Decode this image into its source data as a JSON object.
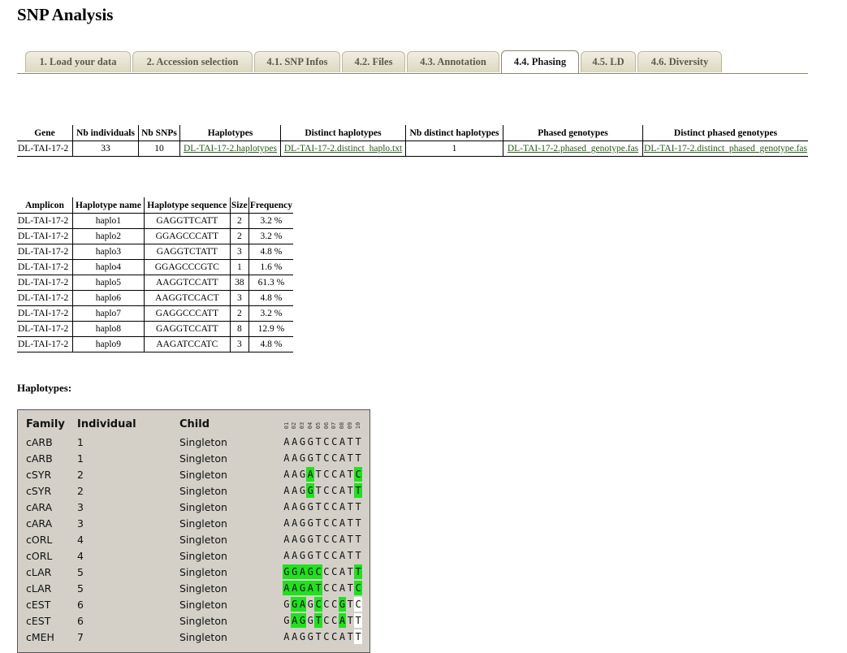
{
  "page": {
    "title": "SNP Analysis"
  },
  "tabs": [
    {
      "label": "1. Load your data",
      "active": false
    },
    {
      "label": "2. Accession selection",
      "active": false
    },
    {
      "label": "4.1. SNP Infos",
      "active": false
    },
    {
      "label": "4.2. Files",
      "active": false
    },
    {
      "label": "4.3. Annotation",
      "active": false
    },
    {
      "label": "4.4. Phasing",
      "active": true
    },
    {
      "label": "4.5. LD",
      "active": false
    },
    {
      "label": "4.6. Diversity",
      "active": false
    }
  ],
  "summary": {
    "headers": [
      "Gene",
      "Nb individuals",
      "Nb SNPs",
      "Haplotypes",
      "Distinct haplotypes",
      "Nb distinct haplotypes",
      "Phased genotypes",
      "Distinct phased genotypes"
    ],
    "row": {
      "gene": "DL-TAI-17-2",
      "nb_individuals": "33",
      "nb_snps": "10",
      "haplotypes_link": "DL-TAI-17-2.haplotypes",
      "distinct_haplotypes_link": "DL-TAI-17-2.distinct_haplo.txt",
      "nb_distinct_haplotypes": "1",
      "phased_genotypes_link": "DL-TAI-17-2.phased_genotype.fas",
      "distinct_phased_genotypes_link": "DL-TAI-17-2.distinct_phased_genotype.fas"
    }
  },
  "haplo_table": {
    "headers": [
      "Amplicon",
      "Haplotype name",
      "Haplotype sequence",
      "Size",
      "Frequency"
    ],
    "rows": [
      [
        "DL-TAI-17-2",
        "haplo1",
        "GAGGTTCATT",
        "2",
        "3.2 %"
      ],
      [
        "DL-TAI-17-2",
        "haplo2",
        "GGAGCCCATT",
        "2",
        "3.2 %"
      ],
      [
        "DL-TAI-17-2",
        "haplo3",
        "GAGGTCTATT",
        "3",
        "4.8 %"
      ],
      [
        "DL-TAI-17-2",
        "haplo4",
        "GGAGCCCGTC",
        "1",
        "1.6 %"
      ],
      [
        "DL-TAI-17-2",
        "haplo5",
        "AAGGTCCATT",
        "38",
        "61.3 %"
      ],
      [
        "DL-TAI-17-2",
        "haplo6",
        "AAGGTCCACT",
        "3",
        "4.8 %"
      ],
      [
        "DL-TAI-17-2",
        "haplo7",
        "GAGGCCCATT",
        "2",
        "3.2 %"
      ],
      [
        "DL-TAI-17-2",
        "haplo8",
        "GAGGTCCATT",
        "8",
        "12.9 %"
      ],
      [
        "DL-TAI-17-2",
        "haplo9",
        "AAGATCCATC",
        "3",
        "4.8 %"
      ]
    ]
  },
  "haplotypes_section": {
    "label": "Haplotypes:"
  },
  "viewer": {
    "headers": {
      "family": "Family",
      "individual": "Individual",
      "child": "Child"
    },
    "positions": [
      "01",
      "02",
      "03",
      "04",
      "05",
      "06",
      "07",
      "08",
      "09",
      "10"
    ],
    "highlight_color": "#22e01f",
    "rows": [
      {
        "family": "cARB",
        "individual": "1",
        "child": "Singleton",
        "seq": "AAGGTCCATT",
        "hl": [],
        "white": []
      },
      {
        "family": "cARB",
        "individual": "1",
        "child": "Singleton",
        "seq": "AAGGTCCATT",
        "hl": [],
        "white": []
      },
      {
        "family": "cSYR",
        "individual": "2",
        "child": "Singleton",
        "seq": "AAGATCCATC",
        "hl": [
          3,
          9
        ],
        "white": []
      },
      {
        "family": "cSYR",
        "individual": "2",
        "child": "Singleton",
        "seq": "AAGGTCCATT",
        "hl": [
          3,
          9
        ],
        "white": []
      },
      {
        "family": "cARA",
        "individual": "3",
        "child": "Singleton",
        "seq": "AAGGTCCATT",
        "hl": [],
        "white": []
      },
      {
        "family": "cARA",
        "individual": "3",
        "child": "Singleton",
        "seq": "AAGGTCCATT",
        "hl": [],
        "white": []
      },
      {
        "family": "cORL",
        "individual": "4",
        "child": "Singleton",
        "seq": "AAGGTCCATT",
        "hl": [],
        "white": []
      },
      {
        "family": "cORL",
        "individual": "4",
        "child": "Singleton",
        "seq": "AAGGTCCATT",
        "hl": [],
        "white": []
      },
      {
        "family": "cLAR",
        "individual": "5",
        "child": "Singleton",
        "seq": "GGAGCCCATT",
        "hl": [
          0,
          1,
          2,
          3,
          4,
          9
        ],
        "white": []
      },
      {
        "family": "cLAR",
        "individual": "5",
        "child": "Singleton",
        "seq": "AAGATCCATC",
        "hl": [
          0,
          1,
          2,
          3,
          4,
          9
        ],
        "white": []
      },
      {
        "family": "cEST",
        "individual": "6",
        "child": "Singleton",
        "seq": "GGAGCCCGTC",
        "hl": [
          1,
          2,
          4,
          7
        ],
        "white": [
          9
        ]
      },
      {
        "family": "cEST",
        "individual": "6",
        "child": "Singleton",
        "seq": "GAGGTCCATT",
        "hl": [
          1,
          2,
          4,
          7
        ],
        "white": [
          9
        ]
      },
      {
        "family": "cMEH",
        "individual": "7",
        "child": "Singleton",
        "seq": "AAGGTCCATT",
        "hl": [],
        "white": [
          9
        ]
      }
    ]
  }
}
